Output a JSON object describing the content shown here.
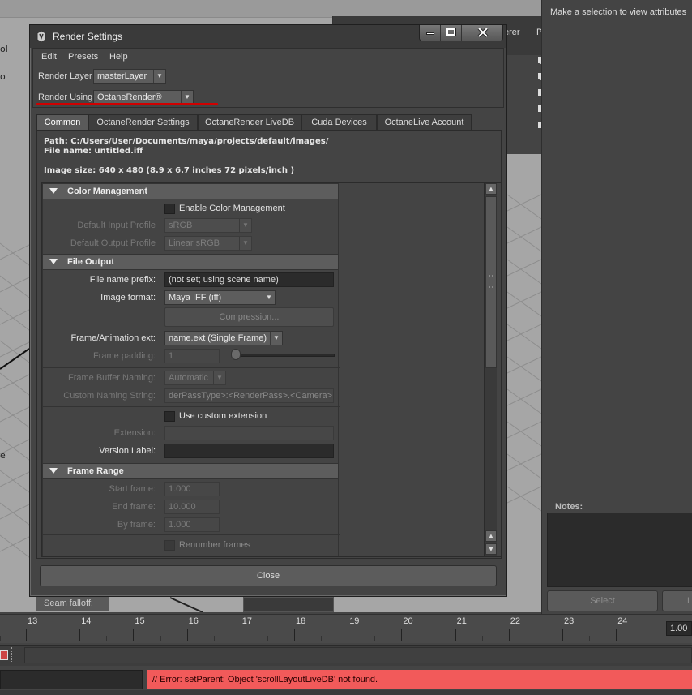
{
  "attribute_editor": {
    "message": "Make a selection to view attributes",
    "notes_label": "Notes:",
    "select_button": "Select",
    "load_button": "L"
  },
  "viewport": {
    "panel_lines": [
      "erer",
      "P",
      "C",
      "C",
      "C",
      "C",
      "C"
    ],
    "seam_label": "Seam falloff:",
    "left_glyphs": [
      "ol",
      "o",
      "e"
    ]
  },
  "dialog": {
    "title": "Render Settings",
    "menu": [
      "Edit",
      "Presets",
      "Help"
    ],
    "render_layer_label": "Render Layer",
    "render_layer_value": "masterLayer",
    "render_using_label": "Render Using",
    "render_using_value": "OctaneRender®",
    "tabs": [
      "Common",
      "OctaneRender Settings",
      "OctaneRender LiveDB",
      "Cuda Devices",
      "OctaneLive Account"
    ],
    "active_tab": "Common",
    "path_line": "Path: C:/Users/User/Documents/maya/projects/default/images/",
    "file_name_line": "File name:  untitled.iff",
    "image_size_line": "Image size: 640 x 480 (8.9 x 6.7 inches 72 pixels/inch )",
    "close_button": "Close"
  },
  "color_management": {
    "header": "Color Management",
    "enable_label": "Enable Color Management",
    "input_profile_label": "Default Input Profile",
    "input_profile_value": "sRGB",
    "output_profile_label": "Default Output Profile",
    "output_profile_value": "Linear sRGB"
  },
  "file_output": {
    "header": "File Output",
    "prefix_label": "File name prefix:",
    "prefix_value": "(not set; using scene name)",
    "format_label": "Image format:",
    "format_value": "Maya IFF (iff)",
    "compression_button": "Compression...",
    "anim_ext_label": "Frame/Animation ext:",
    "anim_ext_value": "name.ext (Single Frame)",
    "padding_label": "Frame padding:",
    "padding_value": "1",
    "buffer_naming_label": "Frame Buffer Naming:",
    "buffer_naming_value": "Automatic",
    "custom_naming_label": "Custom Naming String:",
    "custom_naming_value": "derPassType>:<RenderPass>.<Camera>",
    "custom_ext_label": "Use custom extension",
    "extension_label": "Extension:",
    "extension_value": "",
    "version_label": "Version Label:",
    "version_value": ""
  },
  "frame_range": {
    "header": "Frame Range",
    "start_label": "Start frame:",
    "start_value": "1.000",
    "end_label": "End frame:",
    "end_value": "10.000",
    "by_label": "By frame:",
    "by_value": "1.000",
    "renumber_label": "Renumber frames"
  },
  "timeline": {
    "ticks": [
      "13",
      "14",
      "15",
      "16",
      "17",
      "18",
      "19",
      "20",
      "21",
      "22",
      "23",
      "24"
    ],
    "current_time": "1.00"
  },
  "command": {
    "error": "// Error: setParent: Object 'scrollLayoutLiveDB' not found."
  },
  "colors": {
    "error_bg": "#f25a5a",
    "underline": "#d00000",
    "active_tab": "#5a5a5a"
  }
}
